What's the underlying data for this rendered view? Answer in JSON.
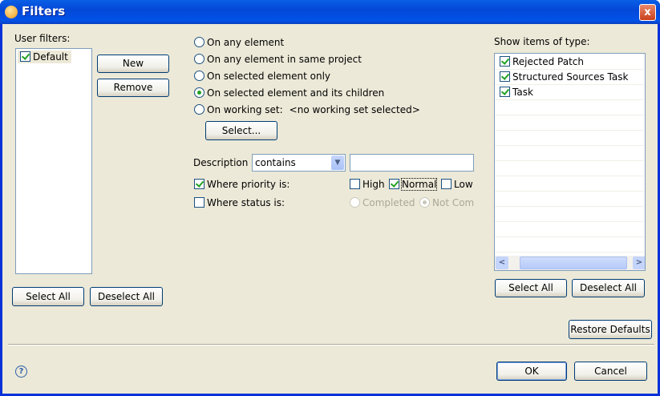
{
  "window": {
    "title": "Filters",
    "close": "x"
  },
  "user_filters": {
    "label": "User filters:",
    "items": [
      {
        "label": "Default",
        "checked": true
      }
    ],
    "new": "New",
    "remove": "Remove",
    "select_all": "Select All",
    "deselect_all": "Deselect All"
  },
  "scope": {
    "options": [
      "On any element",
      "On any element in same project",
      "On selected element only",
      "On selected element and its children",
      "On working set:"
    ],
    "selected": 3,
    "working_set": "<no working set selected>",
    "select_button": "Select..."
  },
  "description": {
    "label": "Description",
    "operator": "contains",
    "value": ""
  },
  "priority": {
    "label": "Where priority is:",
    "checked": true,
    "high": "High",
    "normal": "Normal",
    "low": "Low",
    "high_checked": false,
    "normal_checked": true,
    "low_checked": false
  },
  "status": {
    "label": "Where status is:",
    "checked": false,
    "completed": "Completed",
    "not_completed": "Not Comp"
  },
  "types": {
    "label": "Show items of type:",
    "items": [
      {
        "label": "Rejected Patch",
        "checked": true
      },
      {
        "label": "Structured Sources Task",
        "checked": true
      },
      {
        "label": "Task",
        "checked": true
      }
    ],
    "select_all": "Select All",
    "deselect_all": "Deselect All"
  },
  "footer": {
    "restore": "Restore Defaults",
    "ok": "OK",
    "cancel": "Cancel",
    "help": "?"
  }
}
